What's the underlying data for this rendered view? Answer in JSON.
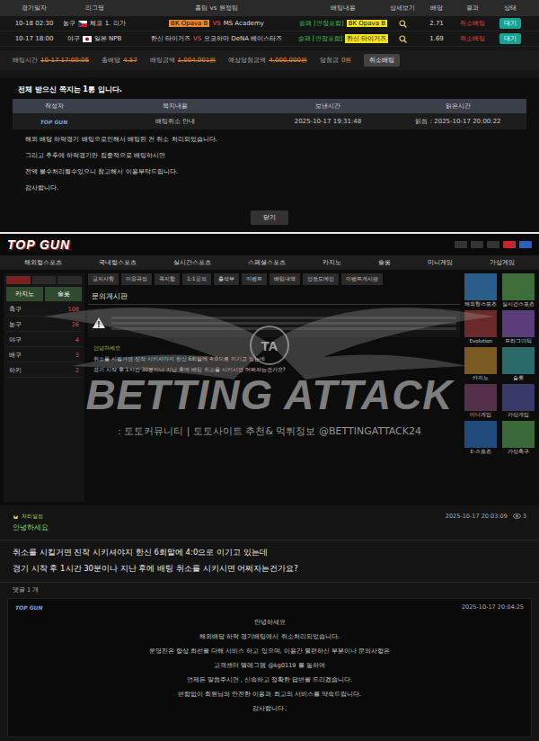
{
  "bet_table": {
    "columns": [
      "경기일자",
      "리그명",
      "홈팀 vs 원정팀",
      "배팅내용",
      "상세보기",
      "배당",
      "결과",
      "상태"
    ],
    "rows": [
      {
        "date": "10-18 02:30",
        "sport": "농구",
        "flag": "czech",
        "league": "체코 1. 리가",
        "home": "BK Opava B",
        "home_picked": true,
        "vs": "VS",
        "away": "MS Academy",
        "market": "승패 [연장포함]",
        "pick": "BK Opava B",
        "odds": "2.71",
        "result": "취소배팅",
        "status": "대기"
      },
      {
        "date": "10-17 18:00",
        "sport": "야구",
        "flag": "japan",
        "league": "일본 NPB",
        "home": "한신 타이거즈",
        "home_picked": false,
        "vs": "VS",
        "away": "요코하마 DeNA 베이스타즈",
        "market": "승패 [연장포함]",
        "pick": "한신 타이거즈",
        "odds": "1.69",
        "result": "취소배팅",
        "status": "대기"
      }
    ],
    "summary": [
      {
        "label": "배팅시간",
        "value": "10-17 17:00:06",
        "struck": true
      },
      {
        "label": "총배당",
        "value": "4.57",
        "struck": true
      },
      {
        "label": "배팅금액",
        "value": "1,004,001원",
        "struck": true
      },
      {
        "label": "예상당첨금액",
        "value": "4,000,000원",
        "struck": true
      },
      {
        "label": "당첨금",
        "value": "0원",
        "struck": false
      }
    ],
    "summary_button": "취소배팅"
  },
  "messages": {
    "count_text": "전체 받으신 쪽지는 1통 입니다.",
    "columns": [
      "작성자",
      "쪽지내용",
      "보낸시간",
      "읽은시간"
    ],
    "row": {
      "sender": "TOP GUN",
      "subject": "배팅취소 안내",
      "sent": "2025-10-17 19:31:48",
      "read": "읽음 : 2025-10-17 20:00:22"
    },
    "body": [
      "해외 배당 하락경기 배팅으로인해서 배팅된 건 취소 처리되었습니다.",
      "그리고 추후에 하락경기만 집중적으로 배팅하시면",
      "전액 몰수처리될수있으니 참고해서 이용부탁드립니다.",
      "감사합니다."
    ],
    "close_button": "닫기"
  },
  "site": {
    "logo": "TOP GUN",
    "nav": [
      "해외형스포츠",
      "국내형스포츠",
      "실시간스포츠",
      "스페셜스포츠",
      "카지노",
      "슬롯",
      "미니게임",
      "가상게임"
    ],
    "side_boxes": [
      "카지노",
      "슬롯"
    ],
    "sports": [
      {
        "name": "축구",
        "count": "108"
      },
      {
        "name": "농구",
        "count": "26"
      },
      {
        "name": "야구",
        "count": "4"
      },
      {
        "name": "배구",
        "count": "3"
      },
      {
        "name": "하키",
        "count": "2"
      }
    ],
    "subtabs": [
      "공지사항",
      "이용규정",
      "쪽지함",
      "1:1문의",
      "출석부",
      "이벤트",
      "배팅내역",
      "안전도메인",
      "이벤트게시판"
    ],
    "board_title": "문의게시판",
    "preview": {
      "title": "안녕하세요",
      "lines": [
        "취소를 시킬거면 진작 시키셔야지 한신 6회말에 4:0으로 이기고 있는데",
        "경기 시작 후 1시간 30분이나 지난 후에 배팅 취소를 시키시면 어쩌자는건가요?"
      ]
    },
    "tiles": [
      "해외형스포츠",
      "실시간스포츠",
      "Evolution",
      "프라그마틱",
      "카지노",
      "슬롯",
      "미니게임",
      "가상게임",
      "E-스포츠",
      "가상축구"
    ]
  },
  "watermark": {
    "badge": "TA",
    "title": "BETTING ATTACK",
    "subtitle": ": 토토커뮤니티 | 토토사이트 추천& 먹튀정보 @BETTINGATTACK24"
  },
  "post": {
    "badge": "처리일정",
    "title": "안녕하세요",
    "date": "2025-10-17 20:03:09",
    "views": "3",
    "body": [
      "취소를 시킬거면 진작 시키셔야지 한신 6회말에 4:0으로 이기고 있는데",
      "경기 시작 후 1시간 30분이나 지난 후에 배팅 취소를 시키시면 어쩌자는건가요?"
    ],
    "comments_label": "댓글 1 개",
    "reply": {
      "author": "TOP GUN",
      "date": "2025-10-17 20:04:25",
      "lines": [
        "안녕하세요",
        "해외배당 하락 경기배팅에서 취소처리되었습니다.",
        "운영진은 항상 최선을 다해 서비스 하고 있으며, 이용간 불편하신 부분이나 문의사항은",
        "고객센터 텔레그램 @kg0119 를 통하여",
        "언제든 말씀주시면 , 신속하고 정확한 답변을 드리겠습니다.",
        "변함없이 회원님의 안전한 이용과 최고의 서비스를 약속드립니다.",
        "감사합니다."
      ]
    }
  }
}
